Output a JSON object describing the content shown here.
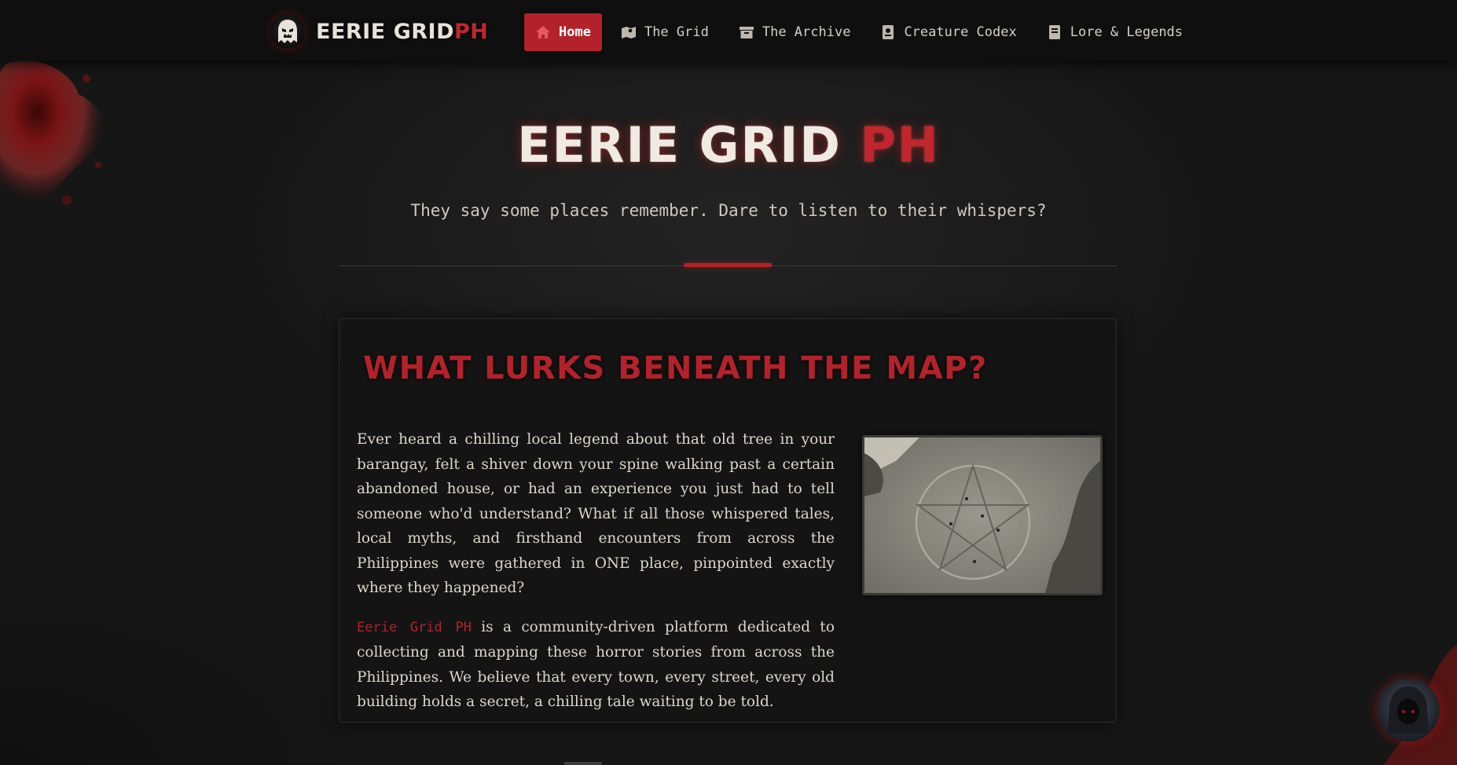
{
  "brand": {
    "name_main": "EERIE GRID",
    "name_accent": "PH",
    "logo_icon": "ghost-icon"
  },
  "nav": {
    "items": [
      {
        "label": "Home",
        "icon": "home-icon",
        "active": true
      },
      {
        "label": "The Grid",
        "icon": "map-icon",
        "active": false
      },
      {
        "label": "The Archive",
        "icon": "archive-icon",
        "active": false
      },
      {
        "label": "Creature Codex",
        "icon": "book-icon",
        "active": false
      },
      {
        "label": "Lore & Legends",
        "icon": "book-open-icon",
        "active": false
      }
    ]
  },
  "hero": {
    "title_main": "EERIE GRID",
    "title_accent": "PH",
    "tagline": "They say some places remember. Dare to listen to their whispers?"
  },
  "card": {
    "title": "What Lurks Beneath The Map?",
    "paragraph1": "Ever heard a chilling local legend about that old tree in your barangay, felt a shiver down your spine walking past a certain abandoned house, or had an experience you just had to tell someone who'd understand? What if all those whispered tales, local myths, and firsthand encounters from across the Philippines were gathered in ONE place, pinpointed exactly where they happened?",
    "paragraph2_brand": "Eerie Grid PH",
    "paragraph2_rest": " is a community-driven platform dedicated to collecting and mapping these horror stories from across the Philippines. We believe that every town, every street, every old building holds a secret, a chilling tale waiting to be told."
  },
  "colors": {
    "accent": "#b3222a",
    "background": "#161616",
    "navbar": "#0f0f0f",
    "text": "#ddd7cd"
  }
}
